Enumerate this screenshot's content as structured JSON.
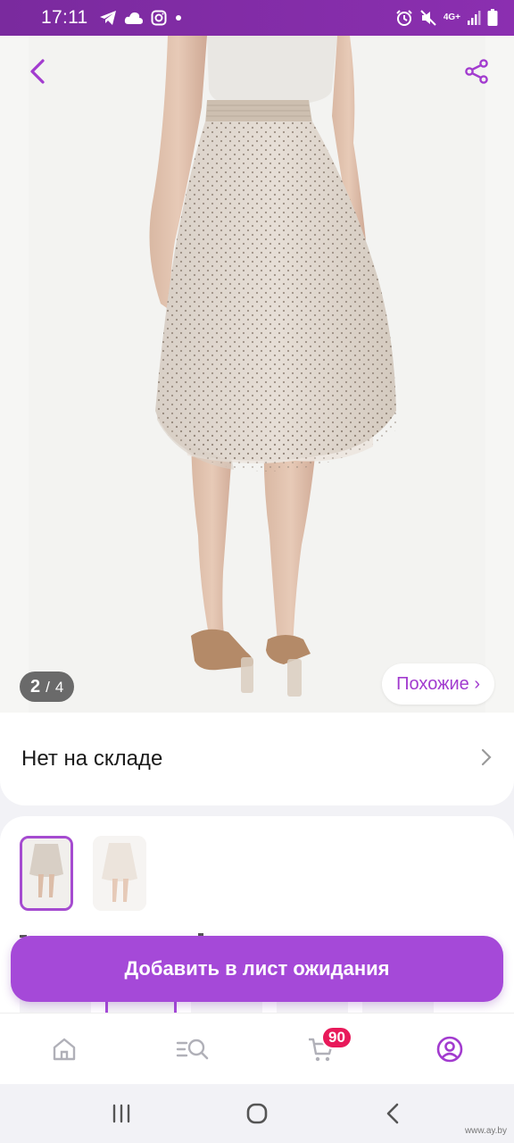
{
  "status_bar": {
    "time": "17:11",
    "network": "4G+"
  },
  "gallery": {
    "current": "2",
    "separator": "/",
    "total": "4",
    "similar_label": "Похожие ›"
  },
  "stock": {
    "label": "Нет на складе"
  },
  "cta": {
    "label": "Добавить в лист ожидания"
  },
  "bottom_nav": {
    "cart_badge": "90",
    "items": [
      "home-icon",
      "catalog-search-icon",
      "cart-icon",
      "profile-icon"
    ]
  },
  "colors": {
    "accent": "#a549d8",
    "status_bar": "#7a2a9e",
    "badge": "#e8195a"
  },
  "watermark": "www.ay.by"
}
